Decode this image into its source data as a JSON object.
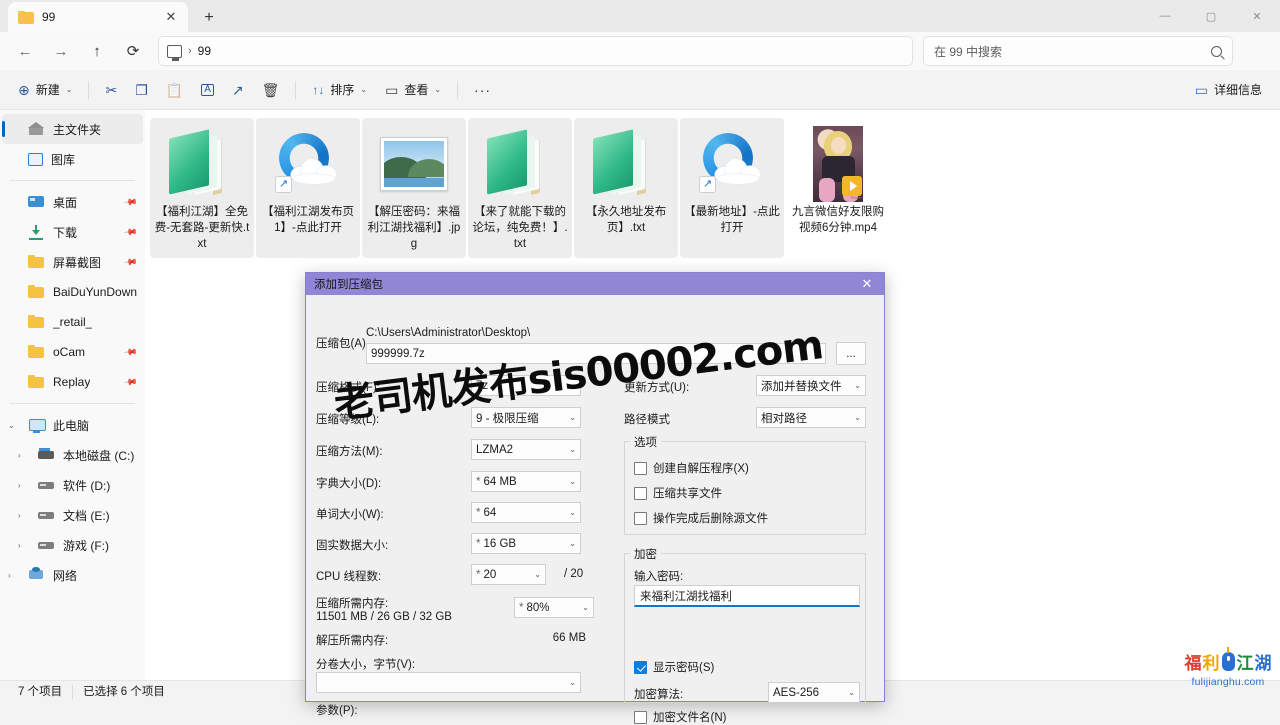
{
  "window": {
    "tab_title": "99",
    "tab_close": "✕",
    "new_tab": "+",
    "minimize": "—",
    "maximize": "▢",
    "close": "✕"
  },
  "addressbar": {
    "back": "←",
    "forward": "→",
    "up": "↑",
    "refresh": "⟳",
    "root_label": "此电脑",
    "separator": "›",
    "crumb": "99"
  },
  "search": {
    "placeholder": "在 99 中搜索",
    "icon": "search-icon"
  },
  "commandbar": {
    "new_label": "新建",
    "new_glyph": "⊕",
    "cut_glyph": "✂",
    "copy_glyph": "❐",
    "paste_glyph": "📋",
    "rename_glyph": "A",
    "share_glyph": "↗",
    "delete_glyph": "🗑",
    "sort_label": "排序",
    "sort_glyph": "↑↓",
    "view_label": "查看",
    "view_glyph": "▭",
    "more_glyph": "···",
    "details_label": "详细信息",
    "chevron": "⌄"
  },
  "sidebar": {
    "items": [
      {
        "label": "主文件夹",
        "icon": "home-icon",
        "selected": true,
        "pinned": false,
        "indent": 0,
        "chevron": ""
      },
      {
        "label": "图库",
        "icon": "gallery-icon",
        "selected": false,
        "pinned": false,
        "indent": 0,
        "chevron": ""
      },
      {
        "label": "桌面",
        "icon": "desktop-icon",
        "selected": false,
        "pinned": true,
        "indent": 0,
        "chevron": ""
      },
      {
        "label": "下载",
        "icon": "downloads-icon",
        "selected": false,
        "pinned": true,
        "indent": 0,
        "chevron": ""
      },
      {
        "label": "屏幕截图",
        "icon": "folder-icon",
        "selected": false,
        "pinned": true,
        "indent": 0,
        "chevron": ""
      },
      {
        "label": "BaiDuYunDownload",
        "icon": "folder-icon",
        "selected": false,
        "pinned": false,
        "indent": 0,
        "chevron": ""
      },
      {
        "label": "_retail_",
        "icon": "folder-icon",
        "selected": false,
        "pinned": false,
        "indent": 0,
        "chevron": ""
      },
      {
        "label": "oCam",
        "icon": "folder-icon",
        "selected": false,
        "pinned": true,
        "indent": 0,
        "chevron": ""
      },
      {
        "label": "Replay",
        "icon": "folder-icon",
        "selected": false,
        "pinned": true,
        "indent": 0,
        "chevron": ""
      },
      {
        "label": "此电脑",
        "icon": "pc-icon",
        "selected": false,
        "pinned": false,
        "indent": 0,
        "chevron": "⌄"
      },
      {
        "label": "本地磁盘 (C:)",
        "icon": "hdd-c-icon",
        "selected": false,
        "pinned": false,
        "indent": 1,
        "chevron": "›"
      },
      {
        "label": "软件 (D:)",
        "icon": "hdd-icon",
        "selected": false,
        "pinned": false,
        "indent": 1,
        "chevron": "›"
      },
      {
        "label": "文档 (E:)",
        "icon": "hdd-icon",
        "selected": false,
        "pinned": false,
        "indent": 1,
        "chevron": "›"
      },
      {
        "label": "游戏 (F:)",
        "icon": "hdd-icon",
        "selected": false,
        "pinned": false,
        "indent": 1,
        "chevron": "›"
      },
      {
        "label": "网络",
        "icon": "network-icon",
        "selected": false,
        "pinned": false,
        "indent": 0,
        "chevron": "›"
      }
    ]
  },
  "files": [
    {
      "name": "【福利江湖】全免费-无套路-更新快.txt",
      "kind": "txt",
      "selected": true
    },
    {
      "name": "【福利江湖发布页1】-点此打开",
      "kind": "url",
      "selected": true
    },
    {
      "name": "【解压密码：来福利江湖找福利】.jpg",
      "kind": "jpg",
      "selected": true
    },
    {
      "name": "【来了就能下载的论坛，纯免费！】.txt",
      "kind": "txt",
      "selected": true
    },
    {
      "name": "【永久地址发布页】.txt",
      "kind": "txt",
      "selected": true
    },
    {
      "name": "【最新地址】-点此打开",
      "kind": "url",
      "selected": true
    },
    {
      "name": "九言微信好友限购视频6分钟.mp4",
      "kind": "mp4",
      "selected": false
    }
  ],
  "statusbar": {
    "count": "7 个项目",
    "selection": "已选择 6 个项目"
  },
  "dialog": {
    "title": "添加到压缩包",
    "close": "✕",
    "archive_label": "压缩包(A)",
    "archive_path": "C:\\Users\\Administrator\\Desktop\\",
    "archive_name": "999999.7z",
    "browse_label": "...",
    "format_label": "压缩格式(F):",
    "format_value": "7z",
    "level_label": "压缩等级(L):",
    "level_value": "9 - 极限压缩",
    "method_label": "压缩方法(M):",
    "method_value": "LZMA2",
    "dict_label": "字典大小(D):",
    "dict_value": "64 MB",
    "word_label": "单词大小(W):",
    "word_value": "64",
    "solid_label": "固实数据大小:",
    "solid_value": "16 GB",
    "cpu_label": "CPU 线程数:",
    "cpu_value": "20",
    "cpu_total": "/ 20",
    "memcompress_label": "压缩所需内存:",
    "memcompress_value": "11501 MB / 26 GB / 32 GB",
    "mempercent_value": "80%",
    "memdecompress_label": "解压所需内存:",
    "memdecompress_value": "66 MB",
    "volume_label": "分卷大小，字节(V):",
    "volume_value": "",
    "params_label": "参数(P):",
    "update_label": "更新方式(U):",
    "update_value": "添加并替换文件",
    "pathmode_label": "路径模式",
    "pathmode_value": "相对路径",
    "options_group": "选项",
    "opt_sfx": "创建自解压程序(X)",
    "opt_shared": "压缩共享文件",
    "opt_delete": "操作完成后删除源文件",
    "encryption_group": "加密",
    "password_label": "输入密码:",
    "password_value": "来福利江湖找福利",
    "showpassword_label": "显示密码(S)",
    "algorithm_label": "加密算法:",
    "algorithm_value": "AES-256",
    "encryptnames_label": "加密文件名(N)",
    "star": "*"
  },
  "watermark": {
    "text": "老司机发布sis00002.com"
  },
  "brand": {
    "char1": "福",
    "char2": "利",
    "char3": "江",
    "char4": "湖",
    "url": "fulijianghu.com"
  }
}
